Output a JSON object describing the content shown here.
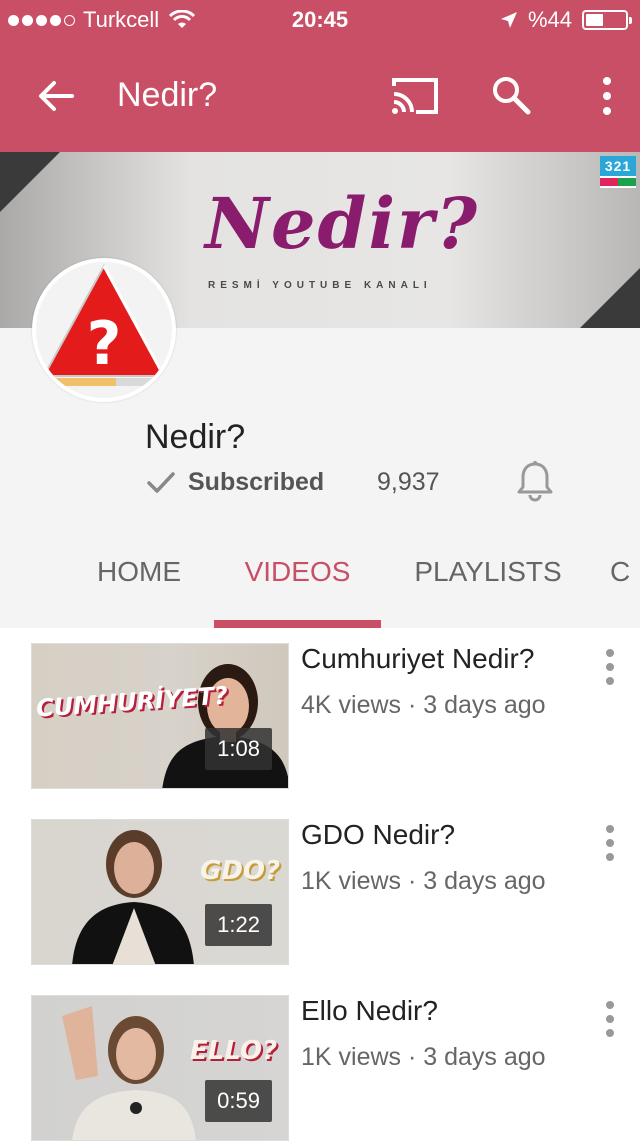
{
  "status_bar": {
    "carrier": "Turkcell",
    "time": "20:45",
    "battery": "%44",
    "battery_level": 0.44
  },
  "app_bar": {
    "title": "Nedir?",
    "back_icon": "arrow-back-icon",
    "cast_icon": "cast-icon",
    "search_icon": "search-icon",
    "more_icon": "more-vert-icon"
  },
  "banner": {
    "brand": "Nedir?",
    "tagline": "RESMİ YOUTUBE KANALI",
    "media_logo": "321"
  },
  "channel": {
    "name": "Nedir?",
    "subscribe_label": "Subscribed",
    "subscriber_count": "9,937"
  },
  "tabs": [
    {
      "label": "HOME",
      "active": false
    },
    {
      "label": "VIDEOS",
      "active": true
    },
    {
      "label": "PLAYLISTS",
      "active": false
    },
    {
      "label": "C",
      "active": false
    }
  ],
  "videos": [
    {
      "title": "Cumhuriyet Nedir?",
      "meta": "4K views · 3 days ago",
      "duration": "1:08",
      "tag": "CUMHURİYET?"
    },
    {
      "title": "GDO Nedir?",
      "meta": "1K views · 3 days ago",
      "duration": "1:22",
      "tag": "GDO?"
    },
    {
      "title": "Ello Nedir?",
      "meta": "1K views · 3 days ago",
      "duration": "0:59",
      "tag": "ELLO?"
    }
  ],
  "colors": {
    "accent": "#c94f67",
    "brand_purple": "#8a1c6e"
  }
}
